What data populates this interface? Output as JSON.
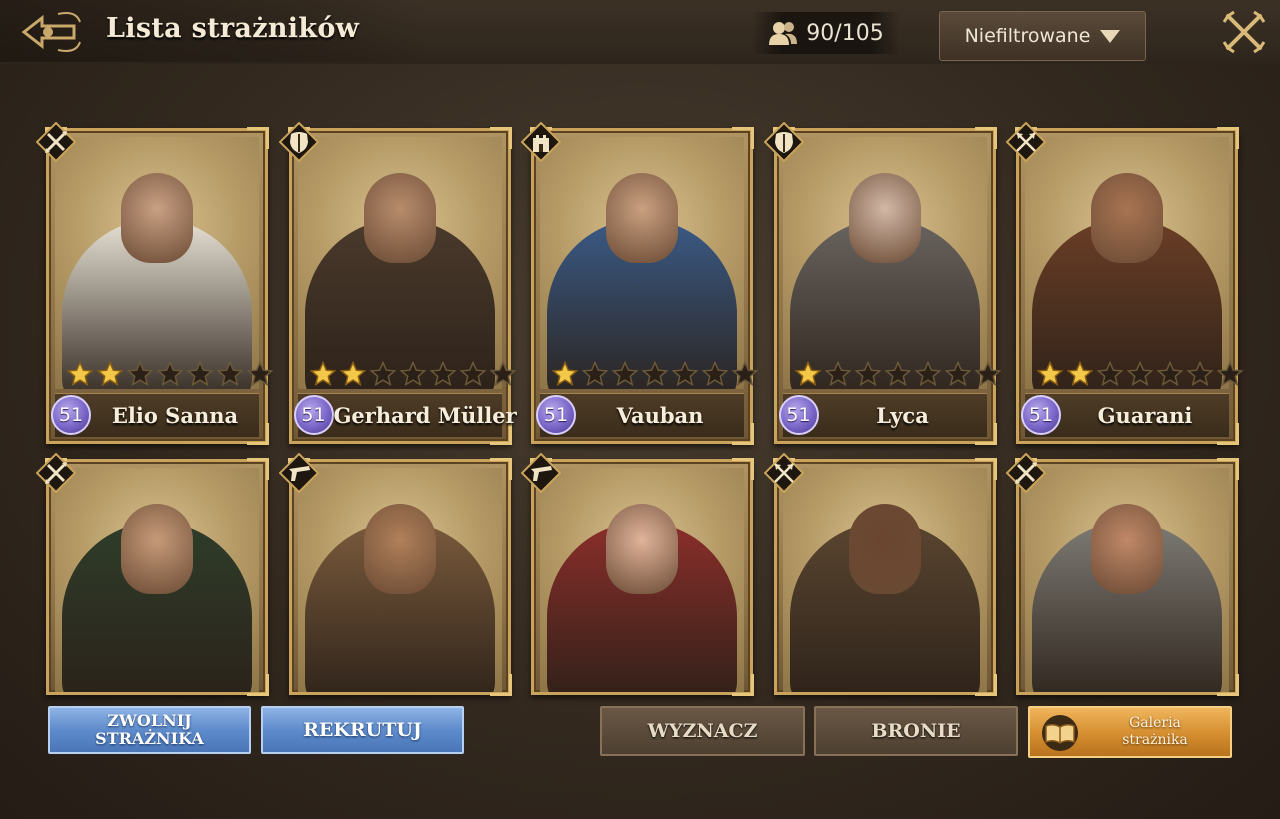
{
  "header": {
    "title": "Lista strażników",
    "guardian_count": "90/105",
    "filter_label": "Niefiltrowane"
  },
  "guardians": [
    {
      "name": "Elio Sanna",
      "level": "51",
      "stars": 2,
      "max_stars": 7,
      "class_icon": "crossed-spears-icon",
      "tone": "#e8e2d6",
      "skin": "#c9a083"
    },
    {
      "name": "Gerhard Müller",
      "level": "51",
      "stars": 2,
      "max_stars": 7,
      "class_icon": "armor-icon",
      "tone": "#4b3a2c",
      "skin": "#b88c6c"
    },
    {
      "name": "Vauban",
      "level": "51",
      "stars": 1,
      "max_stars": 7,
      "class_icon": "castle-icon",
      "tone": "#3a5a86",
      "skin": "#caa080"
    },
    {
      "name": "Lyca",
      "level": "51",
      "stars": 1,
      "max_stars": 7,
      "class_icon": "armor-icon",
      "tone": "#6a6460",
      "skin": "#d2b8a6"
    },
    {
      "name": "Guarani",
      "level": "51",
      "stars": 2,
      "max_stars": 7,
      "class_icon": "crossed-arrows-icon",
      "tone": "#6b3e26",
      "skin": "#a87452"
    },
    {
      "class_icon": "crossed-spears-icon",
      "tone": "#2f3d2a",
      "skin": "#c69a78"
    },
    {
      "class_icon": "pistol-icon",
      "tone": "#7a5a3c",
      "skin": "#b0805a"
    },
    {
      "class_icon": "pistol-icon",
      "tone": "#8b2e2a",
      "skin": "#e0b39a"
    },
    {
      "class_icon": "crossed-arrows-icon",
      "tone": "#5a4530",
      "skin": "#6a4630"
    },
    {
      "class_icon": "crossed-spears-icon",
      "tone": "#7d7a74",
      "skin": "#c08868"
    }
  ],
  "buttons": {
    "dismiss": "ZWOLNIJ STRAŻNIKA",
    "recruit": "REKRUTUJ",
    "assign": "WYZNACZ",
    "weapons": "BRONIE",
    "gallery": "Galeria strażnika"
  },
  "colors": {
    "star_filled": "#f3c848",
    "star_empty": "#2a2017",
    "level_badge": "#7a66c8"
  }
}
